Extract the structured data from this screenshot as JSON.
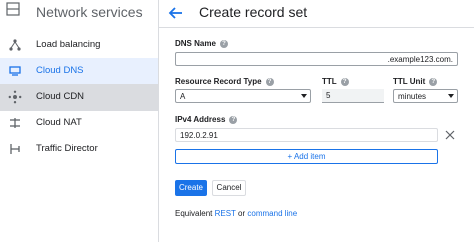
{
  "sidebar": {
    "title": "Network services",
    "items": [
      {
        "label": "Load balancing",
        "icon": "load-balancing-icon"
      },
      {
        "label": "Cloud DNS",
        "icon": "cloud-dns-icon"
      },
      {
        "label": "Cloud CDN",
        "icon": "cloud-cdn-icon"
      },
      {
        "label": "Cloud NAT",
        "icon": "cloud-nat-icon"
      },
      {
        "label": "Traffic Director",
        "icon": "traffic-director-icon"
      }
    ]
  },
  "header": {
    "title": "Create record set"
  },
  "form": {
    "dns_name_label": "DNS Name",
    "dns_name_value": ".example123.com.",
    "record_type_label": "Resource Record Type",
    "record_type_value": "A",
    "ttl_label": "TTL",
    "ttl_value": "5",
    "ttl_unit_label": "TTL Unit",
    "ttl_unit_value": "minutes",
    "ipv4_label": "IPv4 Address",
    "ipv4_value": "192.0.2.91",
    "add_item_label": "Add item"
  },
  "actions": {
    "create_label": "Create",
    "cancel_label": "Cancel"
  },
  "footer": {
    "equivalent": "Equivalent",
    "rest": "REST",
    "or": "or",
    "command_line": "command line"
  },
  "colors": {
    "accent": "#1a73e8",
    "active_bg": "#e8f0fe",
    "hover_bg": "#dadce0"
  }
}
